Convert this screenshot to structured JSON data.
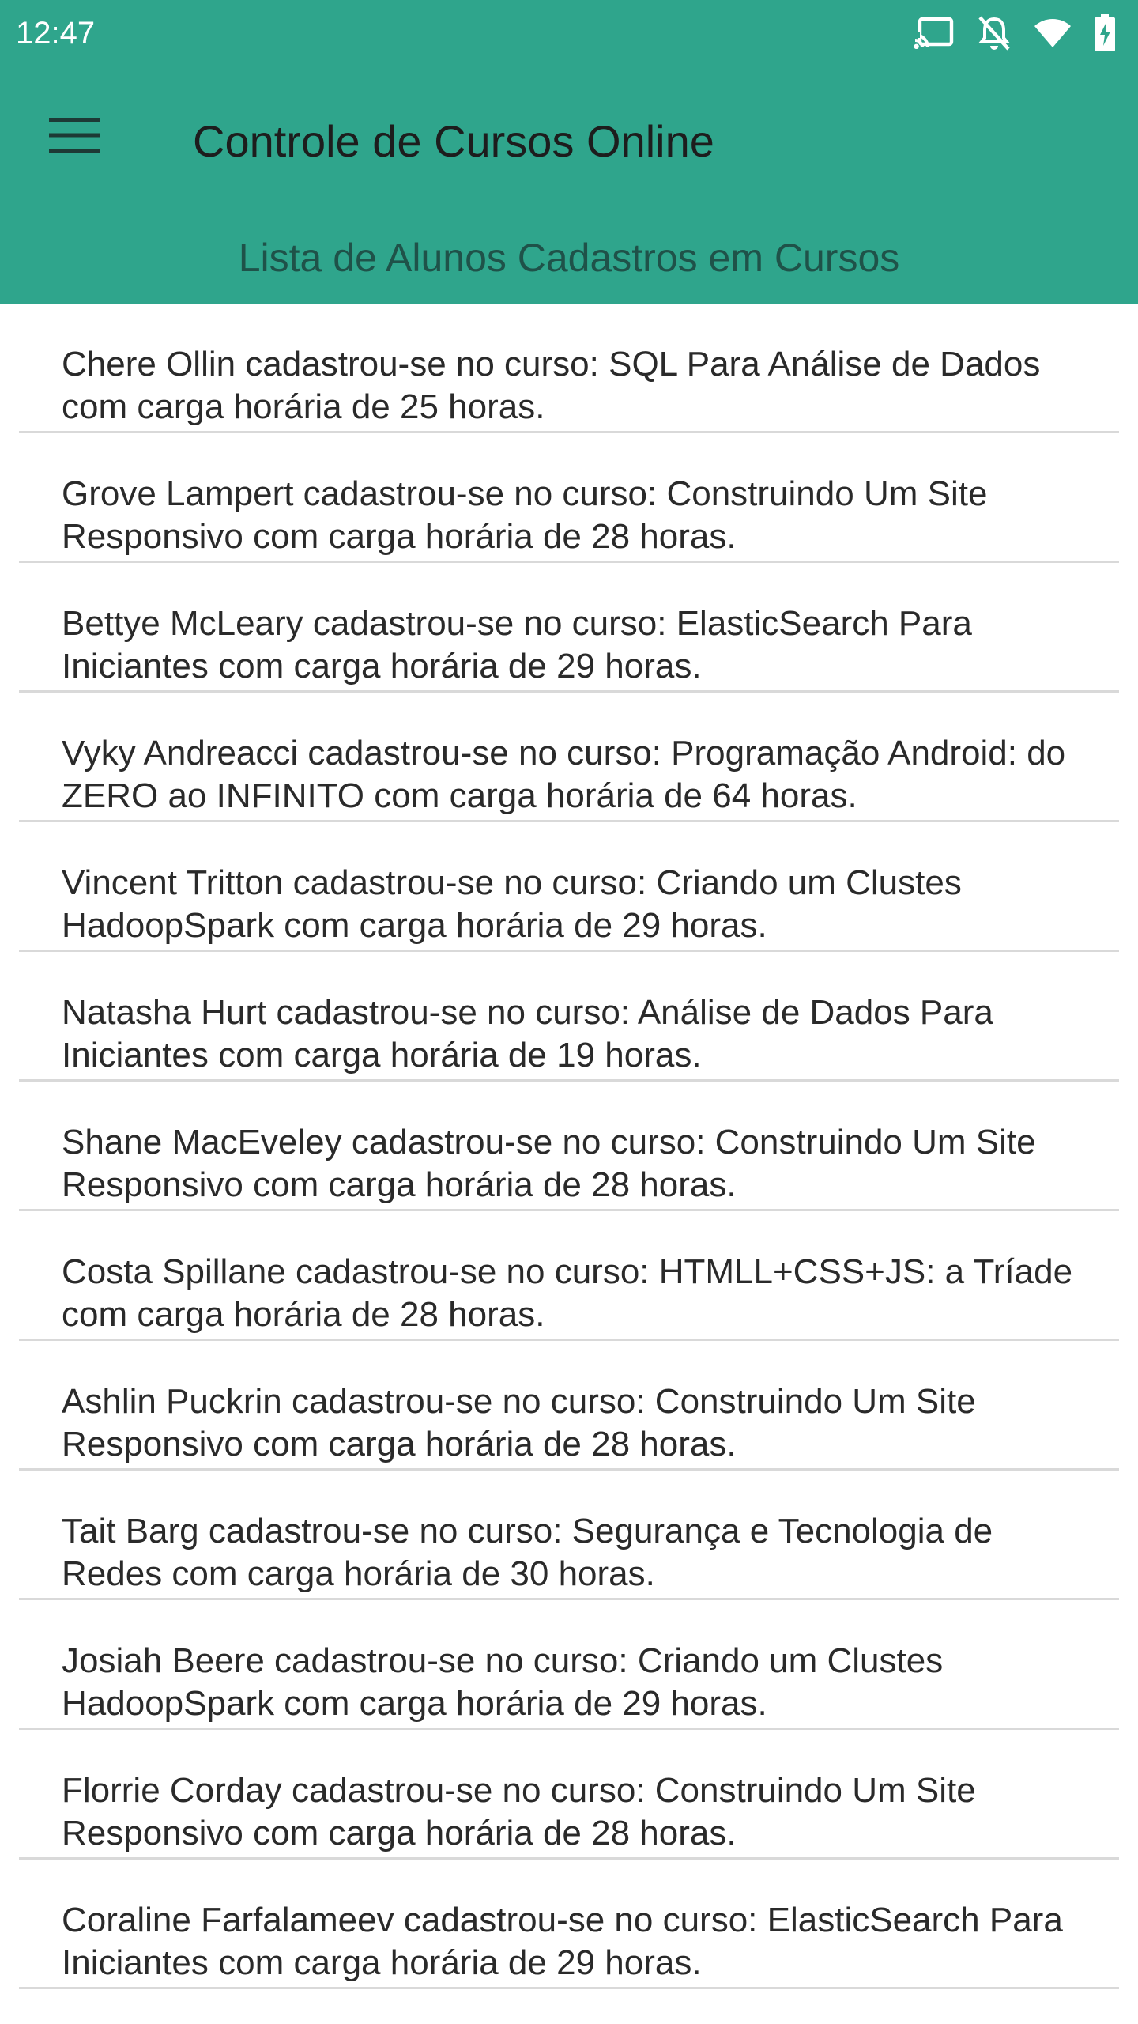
{
  "status_bar": {
    "time": "12:47",
    "icons": [
      "cast-icon",
      "notifications-off-icon",
      "wifi-icon",
      "battery-charging-icon"
    ]
  },
  "toolbar": {
    "menu_icon": "hamburger-menu-icon",
    "title": "Controle de Cursos Online"
  },
  "subtitle": "Lista de Alunos Cadastros em Cursos",
  "colors": {
    "primary": "#2fa58c",
    "title_text": "#1d1d1d",
    "subtitle_text": "#1f5249",
    "divider": "#d9d9d9"
  },
  "enrollments": [
    "Chere Ollin cadastrou-se no curso: SQL Para Análise de Dados com carga horária de 25 horas.",
    "Grove Lampert cadastrou-se no curso: Construindo Um Site Responsivo com carga horária de 28 horas.",
    "Bettye McLeary cadastrou-se no curso: ElasticSearch Para Iniciantes com carga horária de 29 horas.",
    "Vyky Andreacci cadastrou-se no curso: Programação Android: do ZERO ao INFINITO com carga horária de 64 horas.",
    "Vincent Tritton cadastrou-se no curso: Criando um Clustes HadoopSpark com carga horária de 29 horas.",
    "Natasha Hurt cadastrou-se no curso: Análise de Dados Para Iniciantes com carga horária de 19 horas.",
    "Shane MacEveley cadastrou-se no curso: Construindo Um Site Responsivo com carga horária de 28 horas.",
    "Costa Spillane cadastrou-se no curso: HTMLL+CSS+JS: a Tríade com carga horária de 28 horas.",
    "Ashlin Puckrin cadastrou-se no curso: Construindo Um Site Responsivo com carga horária de 28 horas.",
    "Tait Barg cadastrou-se no curso: Segurança e Tecnologia de Redes com carga horária de 30 horas.",
    "Josiah Beere cadastrou-se no curso: Criando um Clustes HadoopSpark com carga horária de 29 horas.",
    "Florrie Corday cadastrou-se no curso: Construindo Um Site Responsivo com carga horária de 28 horas.",
    "Coraline Farfalameev cadastrou-se no curso: ElasticSearch Para Iniciantes com carga horária de 29 horas."
  ]
}
